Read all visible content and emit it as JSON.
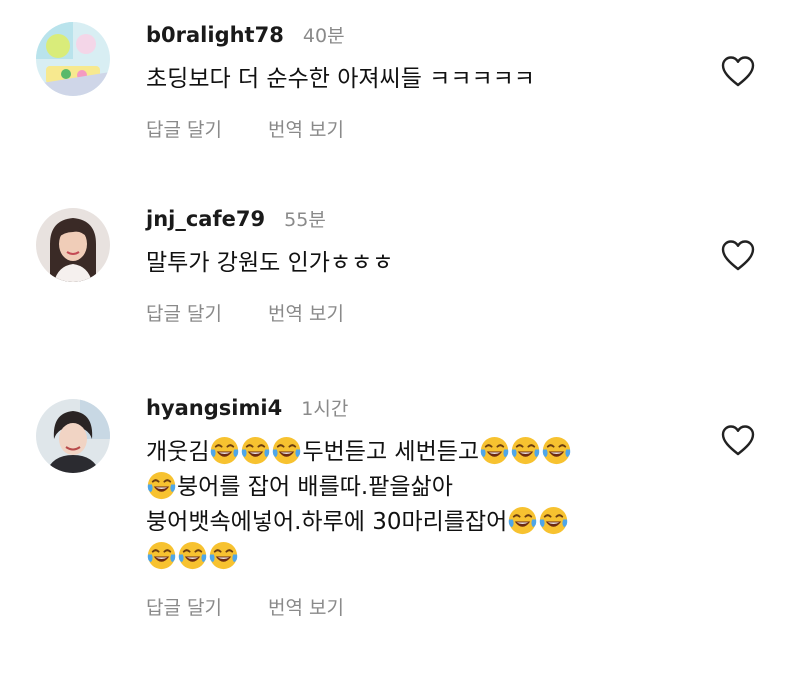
{
  "comments": [
    {
      "username": "b0ralight78",
      "time": "40분",
      "text": "초딩보다 더 순수한 아져씨들 ㅋㅋㅋㅋㅋ",
      "reply_label": "답글 달기",
      "translate_label": "번역 보기"
    },
    {
      "username": "jnj_cafe79",
      "time": "55분",
      "text": "말투가 강원도 인가ㅎㅎㅎ",
      "reply_label": "답글 달기",
      "translate_label": "번역 보기"
    },
    {
      "username": "hyangsimi4",
      "time": "1시간",
      "text_parts": [
        "개웃김",
        "두번듣고 세번듣고",
        "붕어를 잡어 배를따.팥을삶아",
        "붕어뱃속에넣어.하루에 30마리를잡어"
      ],
      "reply_label": "답글 달기",
      "translate_label": "번역 보기"
    }
  ],
  "icons": {
    "like": "heart-outline-icon",
    "laugh": "face-with-tears-of-joy-emoji"
  },
  "colors": {
    "text": "#111111",
    "secondary": "#8a8a8a",
    "emoji_face": "#f7c230",
    "emoji_tears": "#4fa6e8"
  }
}
